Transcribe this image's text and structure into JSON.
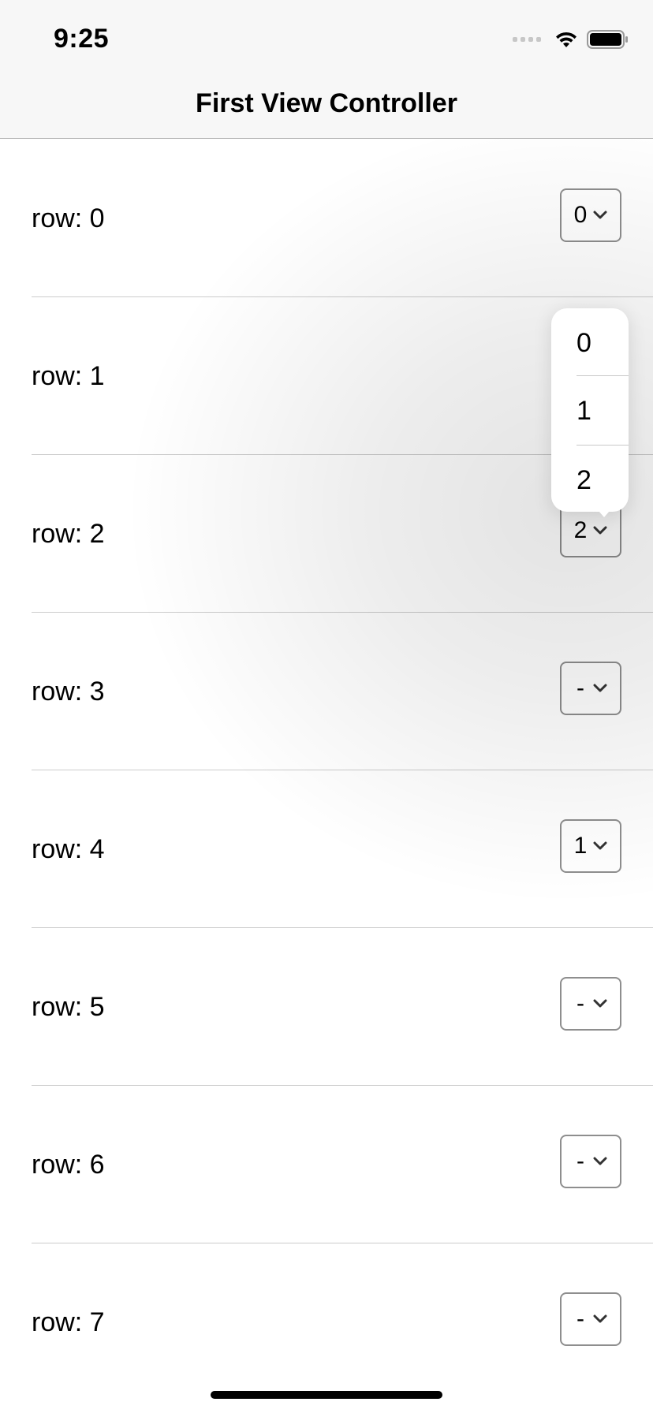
{
  "status_bar": {
    "time": "9:25",
    "icons": [
      "cellular-signal-icon",
      "wifi-icon",
      "battery-icon"
    ]
  },
  "nav": {
    "title": "First View Controller"
  },
  "rows": [
    {
      "label": "row: 0",
      "value": "0"
    },
    {
      "label": "row: 1",
      "value": ""
    },
    {
      "label": "row: 2",
      "value": "2"
    },
    {
      "label": "row: 3",
      "value": "-"
    },
    {
      "label": "row: 4",
      "value": "1"
    },
    {
      "label": "row: 5",
      "value": "-"
    },
    {
      "label": "row: 6",
      "value": "-"
    },
    {
      "label": "row: 7",
      "value": "-"
    }
  ],
  "dropdown": {
    "open_for_row": 2,
    "options": [
      "0",
      "1",
      "2"
    ]
  },
  "colors": {
    "nav_background": "#f7f7f7",
    "separator": "#cccccc",
    "select_border": "#8e8e8e"
  }
}
